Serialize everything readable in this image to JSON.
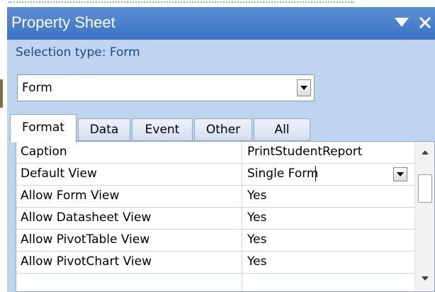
{
  "panel": {
    "title": "Property Sheet",
    "selection_type": "Selection type:  Form"
  },
  "object_select": {
    "value": "Form"
  },
  "tabs": [
    {
      "label": "Format",
      "active": true
    },
    {
      "label": "Data",
      "active": false
    },
    {
      "label": "Event",
      "active": false
    },
    {
      "label": "Other",
      "active": false
    },
    {
      "label": "All",
      "active": false
    }
  ],
  "properties": [
    {
      "name": "Caption",
      "value": "PrintStudentReport"
    },
    {
      "name": "Default View",
      "value": "Single Form"
    },
    {
      "name": "Allow Form View",
      "value": "Yes"
    },
    {
      "name": "Allow Datasheet View",
      "value": "Yes"
    },
    {
      "name": "Allow PivotTable View",
      "value": "Yes"
    },
    {
      "name": "Allow PivotChart View",
      "value": "Yes"
    }
  ],
  "icons": {
    "title_menu": "dropdown-arrow-icon",
    "close": "close-icon",
    "scroll_up": "scroll-up-arrow-icon",
    "scroll_down": "scroll-down-arrow-icon"
  },
  "colors": {
    "title_bar": "#4a82cc",
    "panel_background": "#bfd4ef",
    "selection_text": "#1e4a8a"
  }
}
